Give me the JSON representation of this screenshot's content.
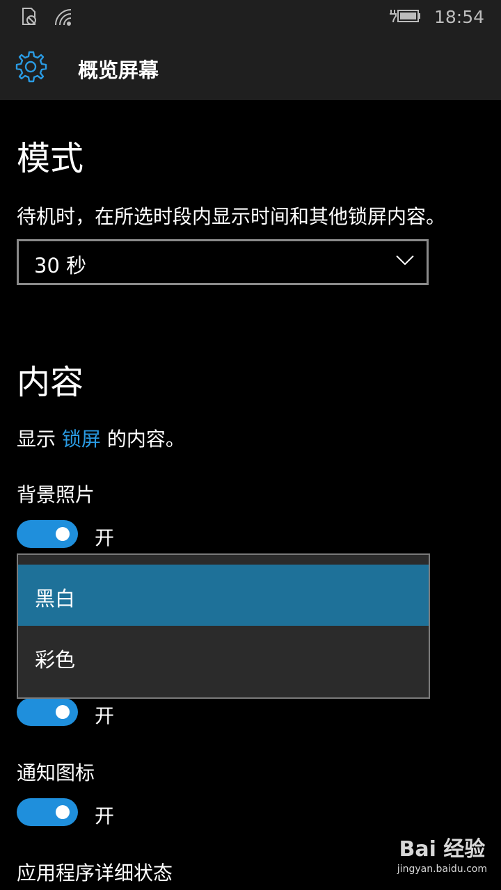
{
  "status_bar": {
    "time": "18:54",
    "icons": [
      "screen-lock-icon",
      "wifi-icon",
      "battery-charging-icon"
    ]
  },
  "header": {
    "title": "概览屏幕",
    "icon": "gear-icon",
    "accent_color": "#2a9be3"
  },
  "mode": {
    "heading": "模式",
    "description": "待机时，在所选时段内显示时间和其他锁屏内容。",
    "select_value": "30 秒"
  },
  "content": {
    "heading": "内容",
    "description_prefix": "显示 ",
    "description_link": "锁屏",
    "description_suffix": " 的内容。",
    "background_label": "背景照片",
    "background_toggle": "开",
    "second_toggle": "开",
    "notification_label": "通知图标",
    "notification_toggle": "开",
    "app_status_label": "应用程序详细状态"
  },
  "dropdown": {
    "options": [
      "黑白",
      "彩色"
    ],
    "selected": "黑白",
    "selected_color": "#1e7199"
  },
  "watermark": {
    "logo": "Bai 经验",
    "url": "jingyan.baidu.com"
  }
}
